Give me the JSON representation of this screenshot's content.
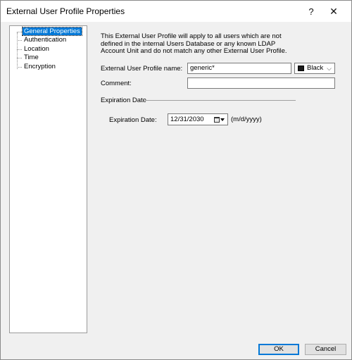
{
  "window": {
    "title": "External User Profile Properties",
    "help_glyph": "?",
    "close_glyph": "✕"
  },
  "tree": {
    "items": [
      {
        "label": "General Properties",
        "selected": true
      },
      {
        "label": "Authentication",
        "selected": false
      },
      {
        "label": "Location",
        "selected": false
      },
      {
        "label": "Time",
        "selected": false
      },
      {
        "label": "Encryption",
        "selected": false
      }
    ]
  },
  "general": {
    "description": "This External User Profile will apply to all users which are not defined in the internal Users Database or any known LDAP Account Unit and do not match any other External User Profile.",
    "profile_name_label": "External User Profile name:",
    "profile_name_value": "generic*",
    "color_value": "Black",
    "comment_label": "Comment:",
    "comment_value": ""
  },
  "expiration": {
    "group_label": "Expiration Date",
    "date_label": "Expiration Date:",
    "date_value": "12/31/2030",
    "date_format_hint": "(m/d/yyyy)"
  },
  "buttons": {
    "ok": "OK",
    "cancel": "Cancel"
  },
  "colors": {
    "selection": "#0078d7",
    "dialog_bg": "#f0f0f0"
  }
}
